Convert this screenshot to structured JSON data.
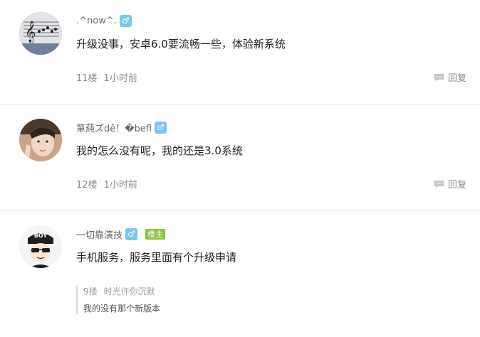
{
  "posts": [
    {
      "username": ".^now^.",
      "gender_symbol": "♂",
      "text": "升级没事，安卓6.0要流畅一些，体验新系统",
      "floor": "11楼",
      "time": "1小时前",
      "reply_label": "回复"
    },
    {
      "username": "箪蒓ズdê！�befl",
      "gender_symbol": "♂",
      "text": "我的怎么没有呢，我的还是3.0系统",
      "floor": "12楼",
      "time": "1小时前",
      "reply_label": "回复"
    },
    {
      "username": "一切靠演技",
      "gender_symbol": "♂",
      "badge": "楼主",
      "avatar_text": "BOY",
      "text": "手机服务，服务里面有个升级申请",
      "sub_reply": {
        "floor": "9楼",
        "author": "时光许你沉默",
        "text": "我的没有那个新版本"
      }
    }
  ],
  "colors": {
    "gender_badge": "#7cc6ee",
    "owner_badge": "#89c540"
  }
}
